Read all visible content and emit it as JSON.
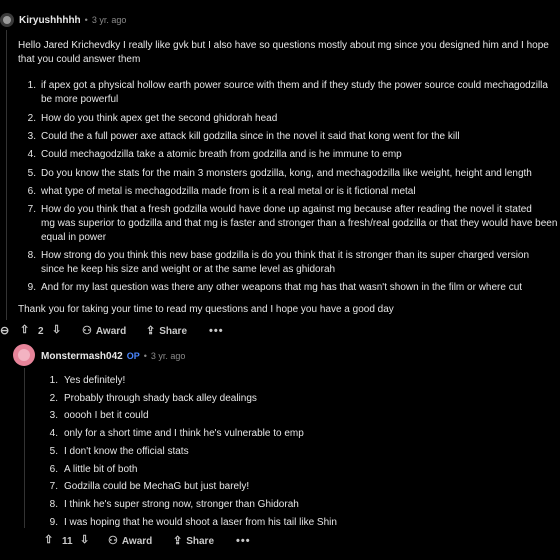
{
  "comment1": {
    "username": "Kiryushhhhh",
    "separator": "•",
    "time": "3 yr. ago",
    "intro": [
      "Hello Jared Krichevdky I really like gvk but I also have so questions mostly about mg since you designed him and I hope",
      "that you could answer them"
    ],
    "questions": [
      {
        "n": "1.",
        "lines": [
          "if apex got a physical hollow earth power source with them and if they study the power source could mechagodzilla",
          "be more powerful"
        ]
      },
      {
        "n": "2.",
        "lines": [
          "How do you think apex get the second ghidorah head"
        ]
      },
      {
        "n": "3.",
        "lines": [
          "Could the a full power axe attack kill godzilla since in the novel it said that kong went for the kill"
        ]
      },
      {
        "n": "4.",
        "lines": [
          "Could mechagodzilla take a atomic breath from godzilla and is he immune to emp"
        ]
      },
      {
        "n": "5.",
        "lines": [
          "Do you know the stats for the main 3 monsters godzilla, kong, and mechagodzilla like weight, height and length"
        ]
      },
      {
        "n": "6.",
        "lines": [
          "what type of metal is mechagodzilla made from is it a real metal or is it fictional metal"
        ]
      },
      {
        "n": "7.",
        "lines": [
          "How do you think that a fresh godzilla would have done up against mg because after reading the novel it stated",
          "mg was superior to godzilla and that mg is faster and stronger than a fresh/real godzilla or that they would have been",
          "equal in power"
        ]
      },
      {
        "n": "8.",
        "lines": [
          "How strong do you think this new base godzilla is do you think that it is stronger than its super charged version",
          "since he keep his size and weight or at the same level as ghidorah"
        ]
      },
      {
        "n": "9.",
        "lines": [
          "And for my last question was there any other weapons that mg has that wasn't shown in the film or where cut"
        ]
      }
    ],
    "outro": "Thank you for taking your time to read my questions and I hope you have a good day",
    "votes": "2",
    "award_label": "Award",
    "share_label": "Share",
    "more_label": "•••"
  },
  "comment2": {
    "username": "Monstermash042",
    "op_badge": "OP",
    "separator": "•",
    "time": "3 yr. ago",
    "answers": [
      {
        "n": "1.",
        "text": "Yes definitely!"
      },
      {
        "n": "2.",
        "text": "Probably through shady back alley dealings"
      },
      {
        "n": "3.",
        "text": "ooooh I bet it could"
      },
      {
        "n": "4.",
        "text": "only for a short time and I think he's vulnerable to emp"
      },
      {
        "n": "5.",
        "text": "I don't know the official stats"
      },
      {
        "n": "6.",
        "text": "A little bit of both"
      },
      {
        "n": "7.",
        "text": "Godzilla could be MechaG but just barely!"
      },
      {
        "n": "8.",
        "text": "I think he's super strong now, stronger than Ghidorah"
      },
      {
        "n": "9.",
        "text": "I was hoping that he would shoot a laser from his tail like Shin"
      }
    ],
    "votes": "11",
    "award_label": "Award",
    "share_label": "Share",
    "more_label": "•••"
  },
  "icons": {
    "upvote": "upvote-icon",
    "downvote": "downvote-icon",
    "award": "award-icon",
    "share": "share-icon",
    "collapse": "collapse-icon"
  }
}
